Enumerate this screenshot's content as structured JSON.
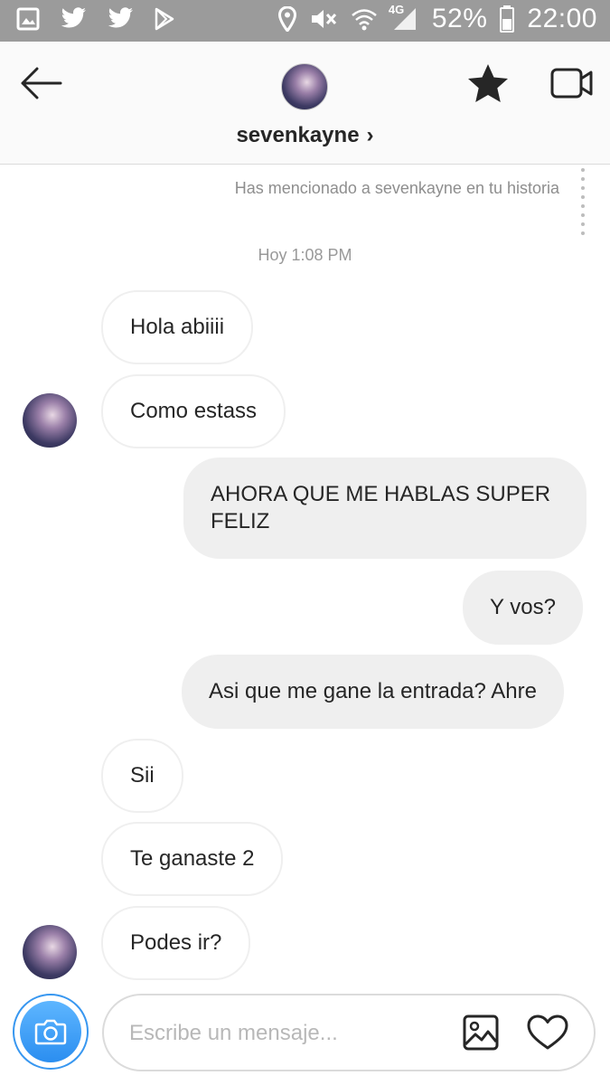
{
  "status_bar": {
    "battery": "52%",
    "time": "22:00",
    "network": "4G"
  },
  "header": {
    "username": "sevenkayne",
    "chevron": "›"
  },
  "chat": {
    "mention_note": "Has mencionado a sevenkayne en tu historia",
    "timestamp": "Hoy 1:08 PM",
    "messages": [
      {
        "from": "them",
        "text": "Hola abiiii"
      },
      {
        "from": "them",
        "text": "Como estass"
      },
      {
        "from": "me",
        "text": "AHORA QUE ME HABLAS SUPER FELIZ"
      },
      {
        "from": "me",
        "text": "Y vos?"
      },
      {
        "from": "me",
        "text": "Asi que me gane la entrada? Ahre"
      },
      {
        "from": "them",
        "text": "Sii"
      },
      {
        "from": "them",
        "text": "Te ganaste 2"
      },
      {
        "from": "them",
        "text": "Podes ir?"
      }
    ]
  },
  "composer": {
    "placeholder": "Escribe un mensaje..."
  },
  "icons": {
    "back": "arrow-left-icon",
    "star": "star-icon",
    "video": "video-camera-icon",
    "camera": "camera-icon",
    "gallery": "image-icon",
    "heart": "heart-icon"
  },
  "colors": {
    "status_bar": "#9b9b9b",
    "accent": "#3897f0",
    "outgoing_bubble": "#efefef"
  }
}
